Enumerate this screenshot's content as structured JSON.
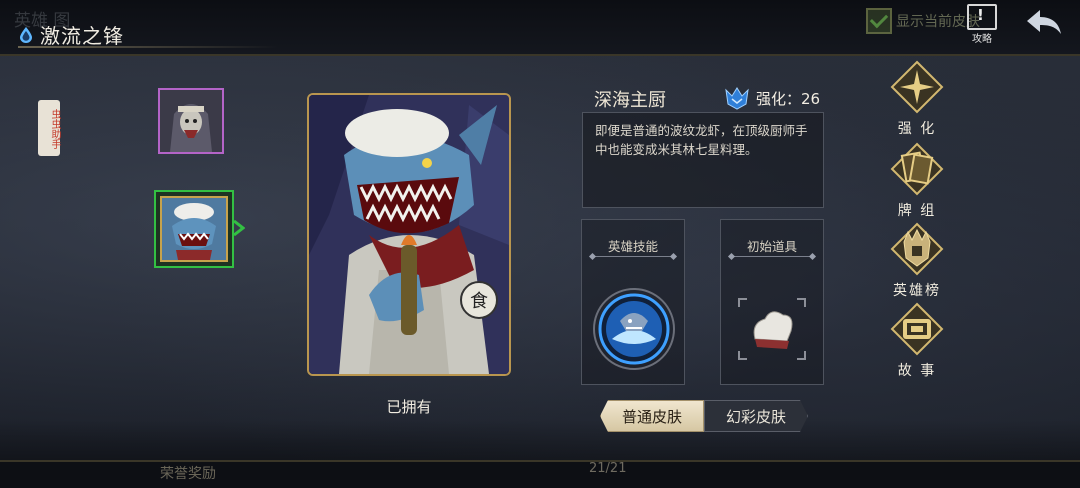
{
  "topbar": {
    "ghost_title": "英雄 图",
    "title": "激流之锋",
    "show_owned_label": "显示当前皮肤",
    "guide_label": "攻略"
  },
  "side_helper": {
    "label": "虫虫助手"
  },
  "heroes": [
    {
      "name": "thumb-1",
      "frame_color": "#b464c8",
      "selected": false
    },
    {
      "name": "thumb-2",
      "frame_color": "#33c043",
      "selected": true
    }
  ],
  "portrait": {
    "status": "已拥有"
  },
  "hero": {
    "name": "深海主厨",
    "enhance_label": "强化：26",
    "description": "即便是普通的波纹龙虾，在顶级厨师手中也能变成米其林七星料理。"
  },
  "panels": {
    "skill_title": "英雄技能",
    "item_title": "初始道具"
  },
  "skin_tabs": {
    "normal": "普通皮肤",
    "illusion": "幻彩皮肤"
  },
  "menu": {
    "enhance": "强 化",
    "deck": "牌 组",
    "ranking": "英雄榜",
    "story": "故 事"
  },
  "bottom": {
    "honor": "荣誉奖励",
    "page": "21/21"
  },
  "colors": {
    "accent_gold": "#c7a34c",
    "selected_green": "#33c043",
    "rare_purple": "#b464c8",
    "enhance_blue": "#2f7fd8"
  }
}
